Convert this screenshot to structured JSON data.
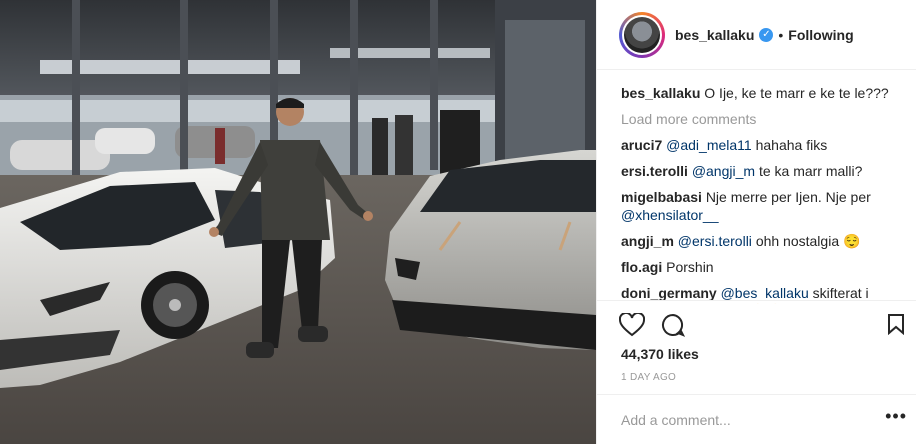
{
  "header": {
    "username": "bes_kallaku",
    "separator": "•",
    "follow_status": "Following"
  },
  "caption": {
    "username": "bes_kallaku",
    "text": "O Ije, ke te marr e ke te le???"
  },
  "load_more": "Load more comments",
  "comments": [
    {
      "user": "aruci7",
      "mention": "@adi_mela11",
      "text": "hahaha fiks"
    },
    {
      "user": "ersi.terolli",
      "mention": "@angji_m",
      "text": "te ka marr malli?"
    },
    {
      "user": "migelbabasi",
      "mention": "",
      "text": "Nje merre per Ijen. Nje per",
      "mention2": "@xhensilator__"
    },
    {
      "user": "angji_m",
      "mention": "@ersi.terolli",
      "text": "ohh nostalgia 😌"
    },
    {
      "user": "flo.agi",
      "mention": "",
      "text": "Porshin"
    },
    {
      "user": "doni_germany",
      "mention": "@bes_kallaku",
      "text": "skifterat i merrin te dyja prape 😂😂🏎"
    }
  ],
  "likes": "44,370 likes",
  "timestamp": "1 DAY AGO",
  "add_comment_placeholder": "Add a comment...",
  "more_label": "•••"
}
